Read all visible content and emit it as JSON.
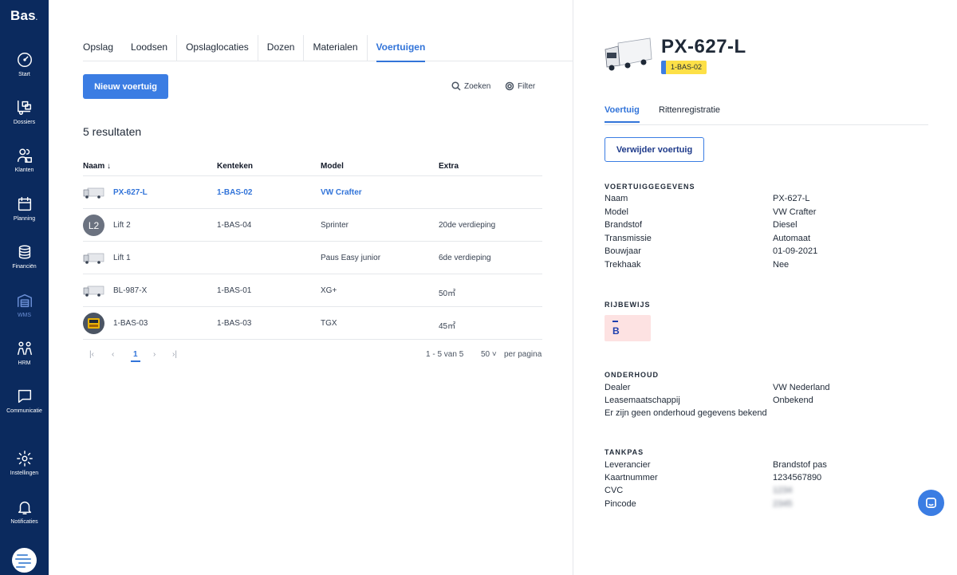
{
  "app": {
    "logo": "Bas"
  },
  "colors": {
    "sidebar": "#0b2a5e",
    "accent": "#3b7de3",
    "badge": "#fde047",
    "license_bg": "#fde2e2"
  },
  "sidebar": {
    "items": [
      {
        "label": "Start",
        "icon": "dashboard-gauge-icon"
      },
      {
        "label": "Dossiers",
        "icon": "truck-loading-icon"
      },
      {
        "label": "Klanten",
        "icon": "clients-icon"
      },
      {
        "label": "Planning",
        "icon": "calendar-icon"
      },
      {
        "label": "Financiën",
        "icon": "coins-icon"
      },
      {
        "label": "WMS",
        "icon": "warehouse-icon",
        "active": true
      },
      {
        "label": "HRM",
        "icon": "people-icon"
      },
      {
        "label": "Communicatie",
        "icon": "chat-bubble-icon"
      },
      {
        "label": "Instellingen",
        "icon": "gear-icon"
      },
      {
        "label": "Notificaties",
        "icon": "bell-icon"
      }
    ]
  },
  "tabs": [
    {
      "label": "Opslag"
    },
    {
      "label": "Loodsen"
    },
    {
      "label": "Opslaglocaties"
    },
    {
      "label": "Dozen"
    },
    {
      "label": "Materialen"
    },
    {
      "label": "Voertuigen",
      "active": true
    }
  ],
  "toolbar": {
    "new_label": "Nieuw voertuig",
    "search_label": "Zoeken",
    "filter_label": "Filter"
  },
  "results_label": "5 resultaten",
  "table": {
    "headers": {
      "name": "Naam",
      "plate": "Kenteken",
      "model": "Model",
      "extra": "Extra"
    },
    "rows": [
      {
        "name": "PX-627-L",
        "plate": "1-BAS-02",
        "model": "VW Crafter",
        "extra": "",
        "thumb": "truck"
      },
      {
        "name": "Lift 2",
        "plate": "1-BAS-04",
        "model": "Sprinter",
        "extra": "20de verdieping",
        "thumb": "initials",
        "initials": "L2"
      },
      {
        "name": "Lift 1",
        "plate": "",
        "model": "Paus Easy junior",
        "extra": "6de verdieping",
        "thumb": "truck"
      },
      {
        "name": "BL-987-X",
        "plate": "1-BAS-01",
        "model": "XG+",
        "extra": "50㎡",
        "thumb": "truck"
      },
      {
        "name": "1-BAS-03",
        "plate": "1-BAS-03",
        "model": "TGX",
        "extra": "45㎡",
        "thumb": "truck-yellow"
      }
    ]
  },
  "pagination": {
    "current": "1",
    "range": "1 - 5 van 5",
    "per_page": "50",
    "per_page_label": "per pagina"
  },
  "detail": {
    "title": "PX-627-L",
    "badge": "1-BAS-02",
    "tabs": {
      "vehicle": "Voertuig",
      "trips": "Rittenregistratie"
    },
    "delete_label": "Verwijder voertuig",
    "sections": {
      "vehicle": {
        "heading": "VOERTUIGGEGEVENS",
        "rows": [
          {
            "key": "Naam",
            "value": "PX-627-L"
          },
          {
            "key": "Model",
            "value": "VW Crafter"
          },
          {
            "key": "Brandstof",
            "value": "Diesel"
          },
          {
            "key": "Transmissie",
            "value": "Automaat"
          },
          {
            "key": "Bouwjaar",
            "value": "01-09-2021"
          },
          {
            "key": "Trekhaak",
            "value": "Nee"
          }
        ]
      },
      "license": {
        "heading": "RIJBEWIJS",
        "category": "B"
      },
      "maintenance": {
        "heading": "ONDERHOUD",
        "rows": [
          {
            "key": "Dealer",
            "value": "VW Nederland"
          },
          {
            "key": "Leasemaatschappij",
            "value": "Onbekend"
          }
        ],
        "note": "Er zijn geen onderhoud gegevens bekend"
      },
      "fuelcard": {
        "heading": "TANKPAS",
        "rows": [
          {
            "key": "Leverancier",
            "value": "Brandstof pas"
          },
          {
            "key": "Kaartnummer",
            "value": "1234567890"
          },
          {
            "key": "CVC",
            "value": "1234"
          },
          {
            "key": "Pincode",
            "value": "2345"
          }
        ]
      }
    }
  }
}
